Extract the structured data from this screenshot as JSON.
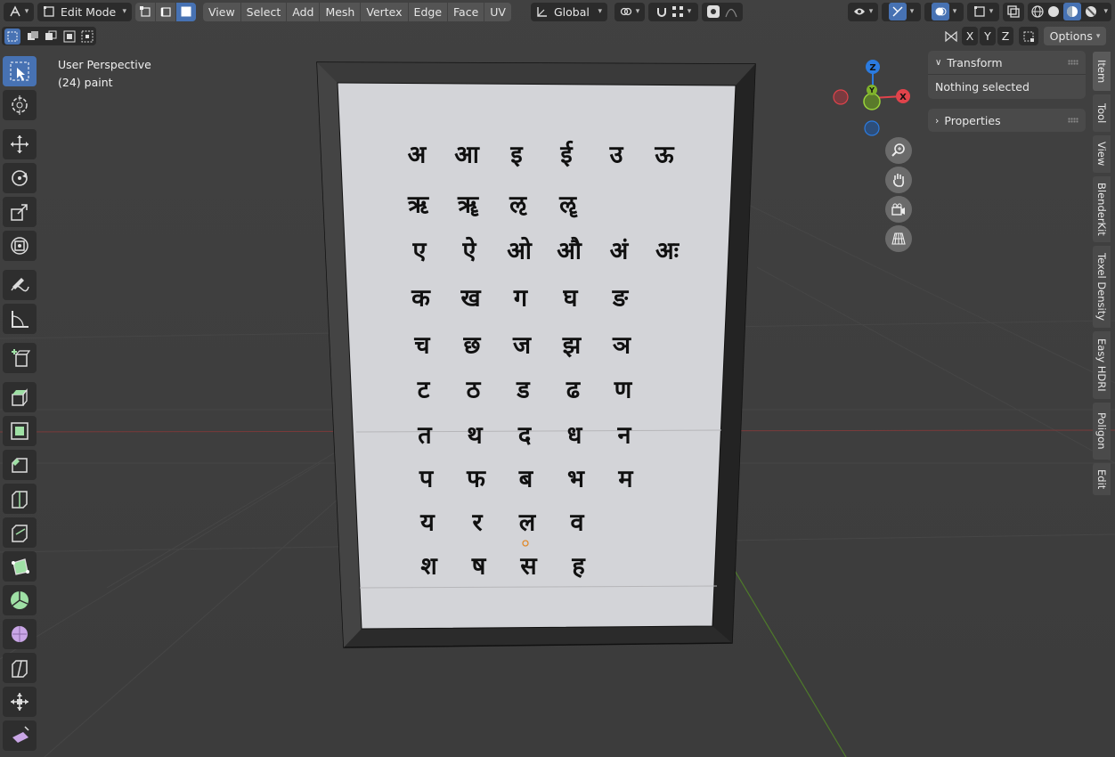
{
  "header": {
    "mode_label": "Edit Mode",
    "menus": [
      "View",
      "Select",
      "Add",
      "Mesh",
      "Vertex",
      "Edge",
      "Face",
      "UV"
    ],
    "transform_orientation": "Global",
    "axis_labels": [
      "X",
      "Y",
      "Z"
    ],
    "options_label": "Options"
  },
  "viewport": {
    "perspective_label": "User Perspective",
    "object_label": "(24) paint",
    "gizmo_axes": {
      "z": "Z",
      "y": "Y",
      "x": "X"
    },
    "colors": {
      "x_axis": "#e0434b",
      "y_axis": "#7fb22b",
      "z_axis": "#2b7be0",
      "active": "#4772b3"
    }
  },
  "sidebar": {
    "transform_title": "Transform",
    "transform_body": "Nothing selected",
    "properties_title": "Properties",
    "tabs": [
      "Item",
      "Tool",
      "View",
      "BlenderKit",
      "Texel Density",
      "Easy HDRI",
      "Poligon",
      "Edit"
    ]
  },
  "toolbar": {
    "tools": [
      "select-box",
      "cursor",
      "move",
      "rotate",
      "scale",
      "transform",
      "annotate",
      "measure",
      "add-cube",
      "extrude",
      "inset",
      "bevel",
      "loop-cut",
      "knife",
      "poly-build",
      "spin",
      "smooth",
      "edge-slide",
      "shrink-fatten",
      "shear",
      "rip"
    ]
  },
  "chart": {
    "rows": [
      [
        "अ",
        "आ",
        "इ",
        "ई",
        "उ",
        "ऊ"
      ],
      [
        "ऋ",
        "ॠ",
        "ऌ",
        "ॡ"
      ],
      [
        "ए",
        "ऐ",
        "ओ",
        "औ",
        "अं",
        "अः"
      ],
      [
        "क",
        "ख",
        "ग",
        "घ",
        "ङ"
      ],
      [
        "च",
        "छ",
        "ज",
        "झ",
        "ञ"
      ],
      [
        "ट",
        "ठ",
        "ड",
        "ढ",
        "ण"
      ],
      [
        "त",
        "थ",
        "द",
        "ध",
        "न"
      ],
      [
        "प",
        "फ",
        "ब",
        "भ",
        "म"
      ],
      [
        "य",
        "र",
        "ल",
        "व"
      ],
      [
        "श",
        "ष",
        "स",
        "ह"
      ]
    ]
  }
}
